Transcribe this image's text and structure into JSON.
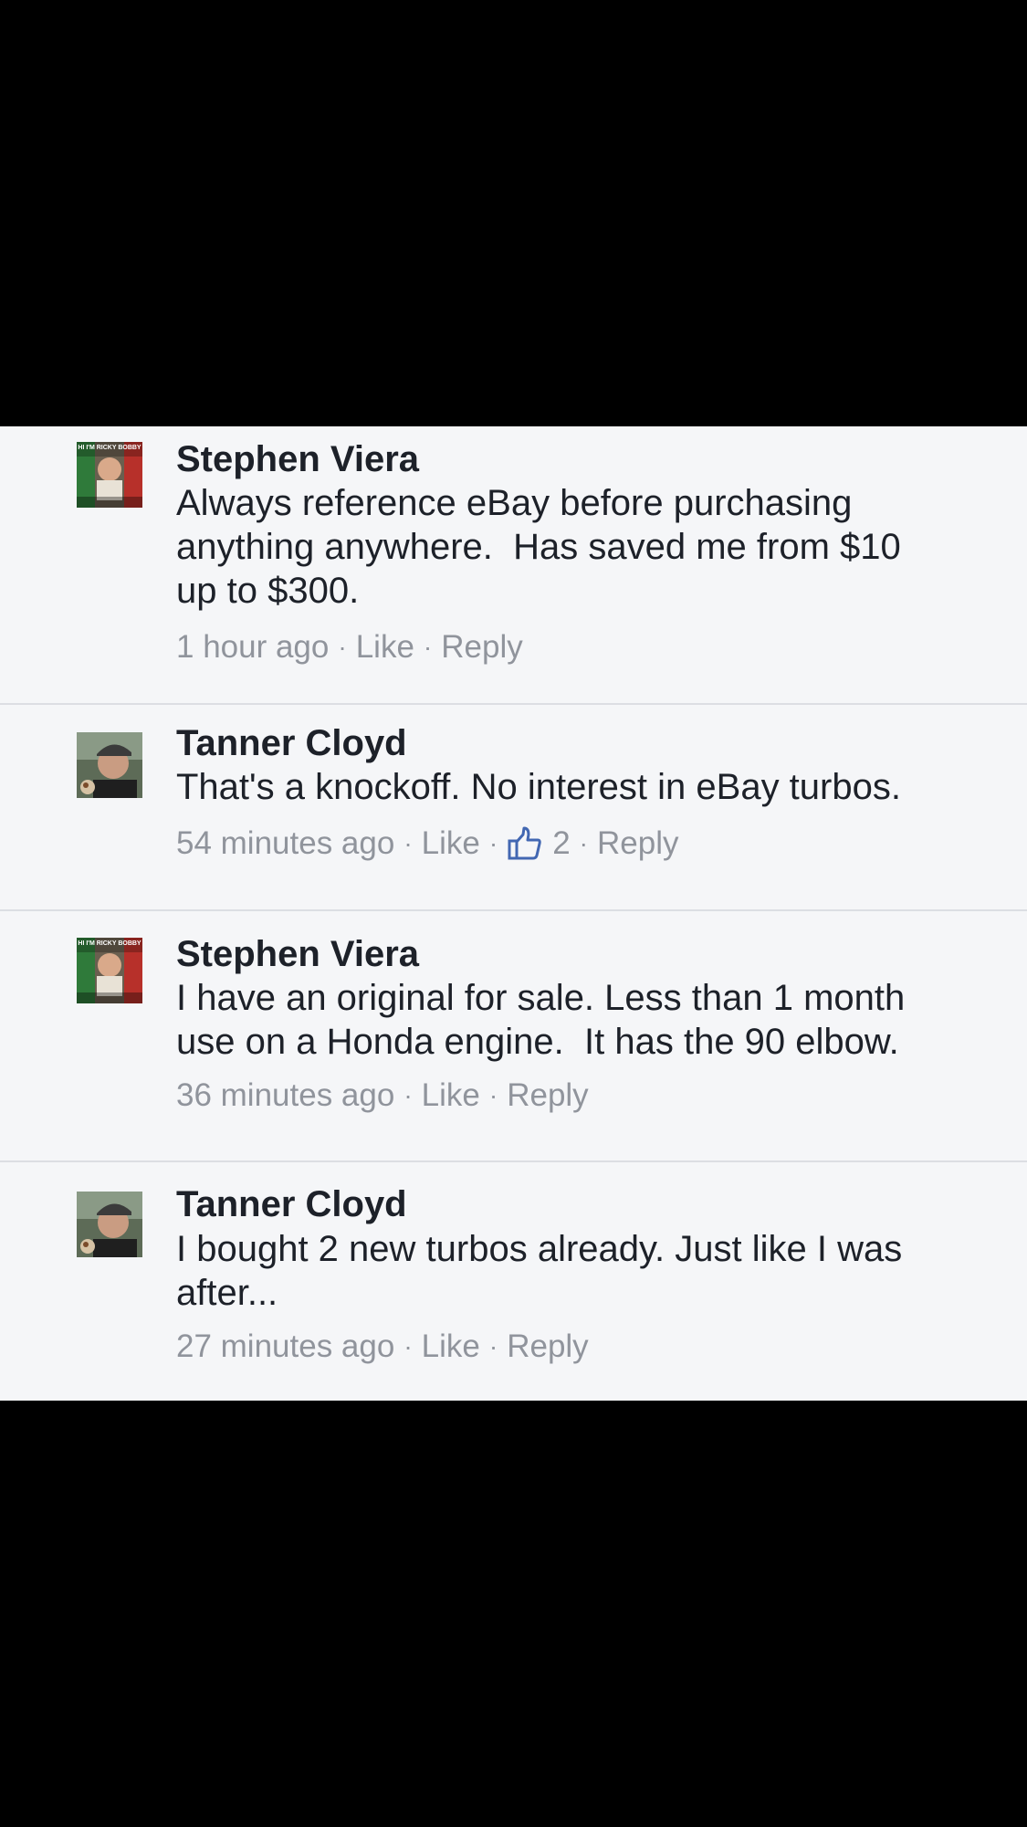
{
  "comments": [
    {
      "author": "Stephen Viera",
      "avatar_icon": "ricky-bobby-meme-avatar",
      "avatar_caption": "HI I'M RICKY BOBBY",
      "lines": [
        "Always reference eBay before purchasing",
        "anything anywhere.  Has saved me from $10",
        "up to $300."
      ],
      "time": "1 hour ago",
      "like_label": "Like",
      "reply_label": "Reply"
    },
    {
      "author": "Tanner Cloyd",
      "avatar_icon": "man-in-cap-avatar",
      "lines": [
        "That's a knockoff. No interest in eBay turbos."
      ],
      "time": "54 minutes ago",
      "like_label": "Like",
      "like_count": "2",
      "reply_label": "Reply"
    },
    {
      "author": "Stephen Viera",
      "avatar_icon": "ricky-bobby-meme-avatar",
      "avatar_caption": "HI I'M RICKY BOBBY",
      "lines": [
        "I have an original for sale. Less than 1 month",
        "use on a Honda engine.  It has the 90 elbow."
      ],
      "time": "36 minutes ago",
      "like_label": "Like",
      "reply_label": "Reply"
    },
    {
      "author": "Tanner Cloyd",
      "avatar_icon": "man-in-cap-avatar",
      "lines": [
        "I bought 2 new turbos already. Just like I was",
        "after..."
      ],
      "time": "27 minutes ago",
      "like_label": "Like",
      "reply_label": "Reply"
    }
  ],
  "separator_dot": "·",
  "colors": {
    "panel_bg": "#f5f6f8",
    "text": "#1d2129",
    "meta": "#90949c",
    "like_icon": "#4267b2",
    "divider": "#dcdee3"
  }
}
